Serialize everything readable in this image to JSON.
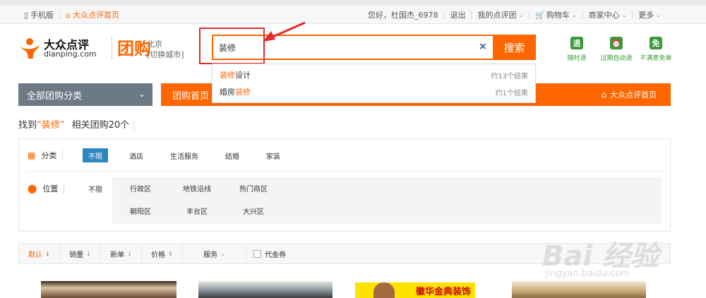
{
  "topbar": {
    "left": [
      {
        "label": "手机版",
        "icon": "mobile-icon"
      },
      {
        "label": "大众点评首页",
        "icon": "home-icon"
      }
    ],
    "right": [
      {
        "label": "您好，杜国杰_6978"
      },
      {
        "label": "退出"
      },
      {
        "label": "我的点评团"
      },
      {
        "label": "购物车"
      },
      {
        "label": "商家中心"
      },
      {
        "label": "更多"
      }
    ]
  },
  "logo": {
    "cn": "大众点评",
    "en": "dianping.com",
    "tuangou": "团购"
  },
  "city": {
    "name": "北京",
    "switch": "[切换城市]"
  },
  "search": {
    "value": "装修",
    "button": "搜索",
    "clear": "×"
  },
  "suggestions": [
    {
      "highlight": "装修",
      "rest": "设计",
      "count": "约13个结果"
    },
    {
      "prefix": "婚房",
      "highlight": "装修",
      "count": "约1个结果"
    }
  ],
  "guarantees": [
    {
      "icon": "退",
      "label": "随时退"
    },
    {
      "icon": "⏰",
      "label": "过期自动退"
    },
    {
      "icon": "免",
      "label": "不满意免单"
    }
  ],
  "nav": {
    "category": "全部团购分类",
    "home": "团购首页",
    "dianping_home": "大众点评首页"
  },
  "result": {
    "prefix": "找到",
    "keyword": "“装修”",
    "suffix": "相关团购20个"
  },
  "filters": {
    "category_label": "分类",
    "categories": [
      "不限",
      "酒店",
      "生活服务",
      "结婚",
      "家装"
    ],
    "location_label": "位置",
    "location_unlimited": "不限",
    "location_tabs": [
      "行政区",
      "地铁沿线",
      "热门商区"
    ],
    "districts": [
      "朝阳区",
      "丰台区",
      "大兴区"
    ]
  },
  "sort": {
    "items": [
      {
        "label": "默认",
        "arrow": "↓"
      },
      {
        "label": "销量",
        "arrow": "↓"
      },
      {
        "label": "新单",
        "arrow": "↓"
      },
      {
        "label": "价格",
        "arrow": "⇕"
      },
      {
        "label": "服务",
        "arrow": "⌄"
      }
    ],
    "voucher": "代金券"
  },
  "thumb_banner": "徽华金典装饰",
  "watermark": {
    "brand": "Bai 经验",
    "url": "jingyan.baidu.com"
  },
  "colors": {
    "accent": "#ff6600",
    "nav_gray": "#6d7a86",
    "green": "#3b9a3b",
    "selected_blue": "#2e86c1",
    "annotation_red": "#e02c2c"
  }
}
